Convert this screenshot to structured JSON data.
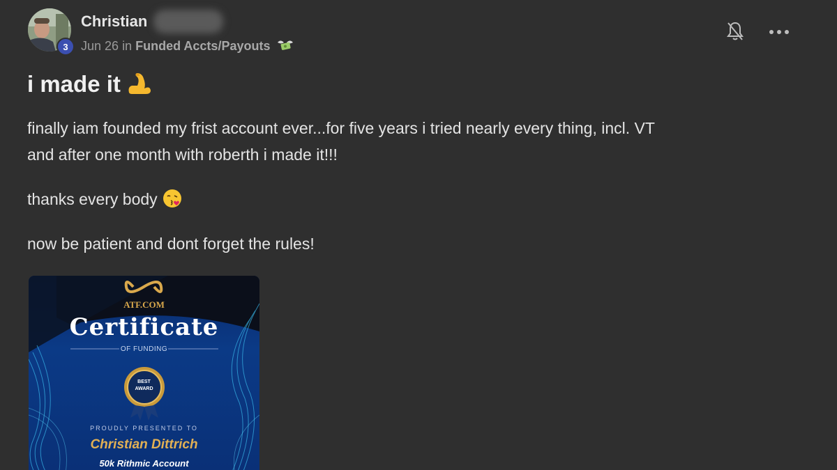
{
  "author": {
    "name": "Christian",
    "level": "3"
  },
  "meta": {
    "date": "Jun 26",
    "in_word": "in",
    "category": "Funded Accts/Payouts",
    "category_icon": "money-wings-icon"
  },
  "actions": {
    "bell_icon": "bell-off-icon",
    "more_icon": "more-dots-icon"
  },
  "post": {
    "title": "i made it",
    "title_emoji": "flexed-biceps-icon",
    "paragraphs": [
      "finally iam founded my frist account ever...for five years i tried nearly every thing, incl. VT",
      "and after one month with roberth i made it!!!",
      "thanks every body",
      "now be patient and dont forget the rules!"
    ],
    "kiss_emoji": "face-blowing-kiss-icon"
  },
  "certificate": {
    "brand": "ATF.COM",
    "heading": "Certificate",
    "subheading": "OF FUNDING",
    "award_line1": "BEST",
    "award_line2": "AWARD",
    "presented_to": "PROUDLY PRESENTED TO",
    "recipient": "Christian Dittrich",
    "account": "50k Rithmic Account"
  },
  "colors": {
    "background": "#2f2f2f",
    "level_badge": "#3b4fb0",
    "certificate_gold": "#e2b054"
  }
}
